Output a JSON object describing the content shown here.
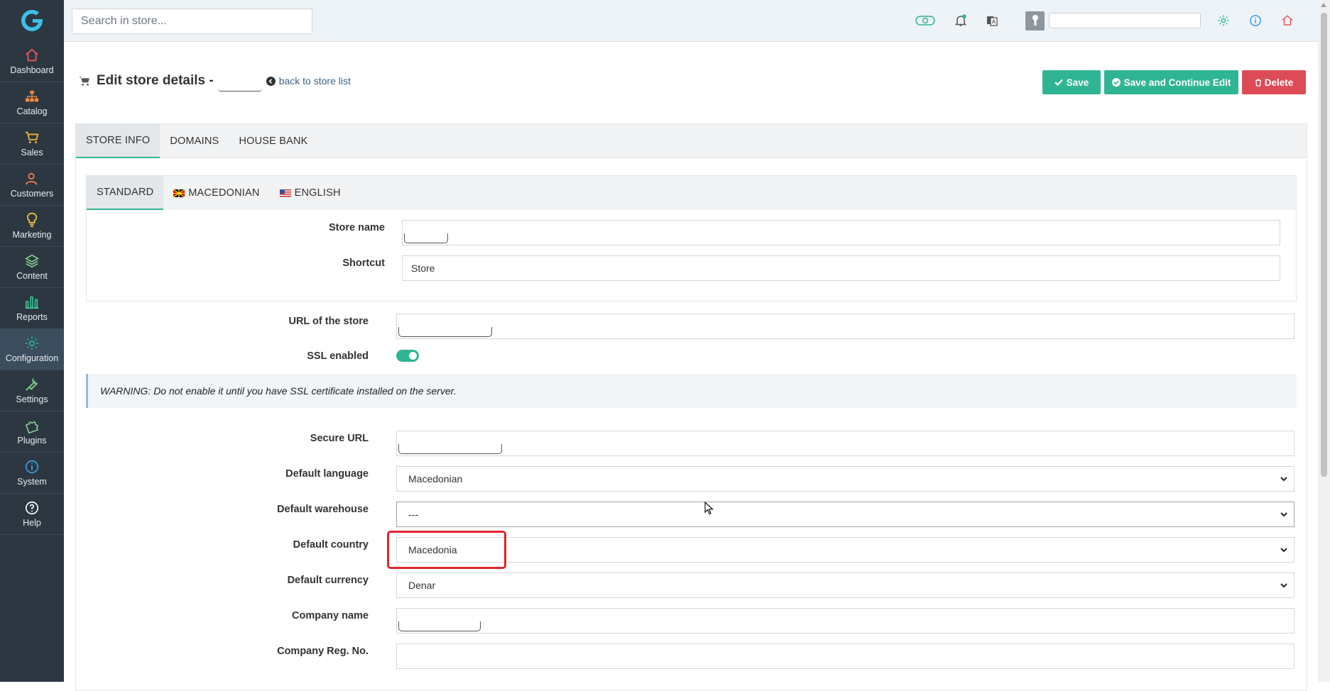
{
  "sidebar": {
    "items": [
      {
        "label": "Dashboard",
        "icon": "home-icon",
        "color": "#e8555f"
      },
      {
        "label": "Catalog",
        "icon": "sitemap-icon",
        "color": "#f08a3c"
      },
      {
        "label": "Sales",
        "icon": "cart-icon",
        "color": "#f0b43c"
      },
      {
        "label": "Customers",
        "icon": "users-icon",
        "color": "#f07b53"
      },
      {
        "label": "Marketing",
        "icon": "lightbulb-icon",
        "color": "#f0c03c"
      },
      {
        "label": "Content",
        "icon": "layers-icon",
        "color": "#7ed08a"
      },
      {
        "label": "Reports",
        "icon": "bar-chart-icon",
        "color": "#3cbf8f"
      },
      {
        "label": "Configuration",
        "icon": "gear-icon",
        "color": "#2fb593"
      },
      {
        "label": "Settings",
        "icon": "wrench-icon",
        "color": "#7ed08a"
      },
      {
        "label": "Plugins",
        "icon": "puzzle-icon",
        "color": "#7ed08a"
      },
      {
        "label": "System",
        "icon": "info-icon",
        "color": "#3c9ee8"
      },
      {
        "label": "Help",
        "icon": "question-icon",
        "color": "#ffffff"
      }
    ],
    "active": "Configuration"
  },
  "topbar": {
    "search_placeholder": "Search in store..."
  },
  "header": {
    "title": "Edit store details -",
    "back_link": "back to store list"
  },
  "buttons": {
    "save": "Save",
    "save_continue": "Save and Continue Edit",
    "delete": "Delete"
  },
  "tabs": [
    "STORE INFO",
    "DOMAINS",
    "HOUSE BANK"
  ],
  "lang_tabs": [
    "STANDARD",
    "MACEDONIAN",
    "ENGLISH"
  ],
  "form": {
    "store_name_label": "Store name",
    "shortcut_label": "Shortcut",
    "shortcut_value": "Store",
    "url_label": "URL of the store",
    "ssl_label": "SSL enabled",
    "warning": "WARNING: Do not enable it until you have SSL certificate installed on the server.",
    "secure_url_label": "Secure URL",
    "default_language_label": "Default language",
    "default_language_value": "Macedonian",
    "default_warehouse_label": "Default warehouse",
    "default_warehouse_value": "---",
    "default_country_label": "Default country",
    "default_country_value": "Macedonia",
    "default_currency_label": "Default currency",
    "default_currency_value": "Denar",
    "company_name_label": "Company name",
    "company_reg_label": "Company Reg. No."
  },
  "colors": {
    "accent": "#2fb593",
    "danger": "#dd4b57",
    "sidebar_bg": "#2d3741",
    "highlight": "#e1252f"
  }
}
